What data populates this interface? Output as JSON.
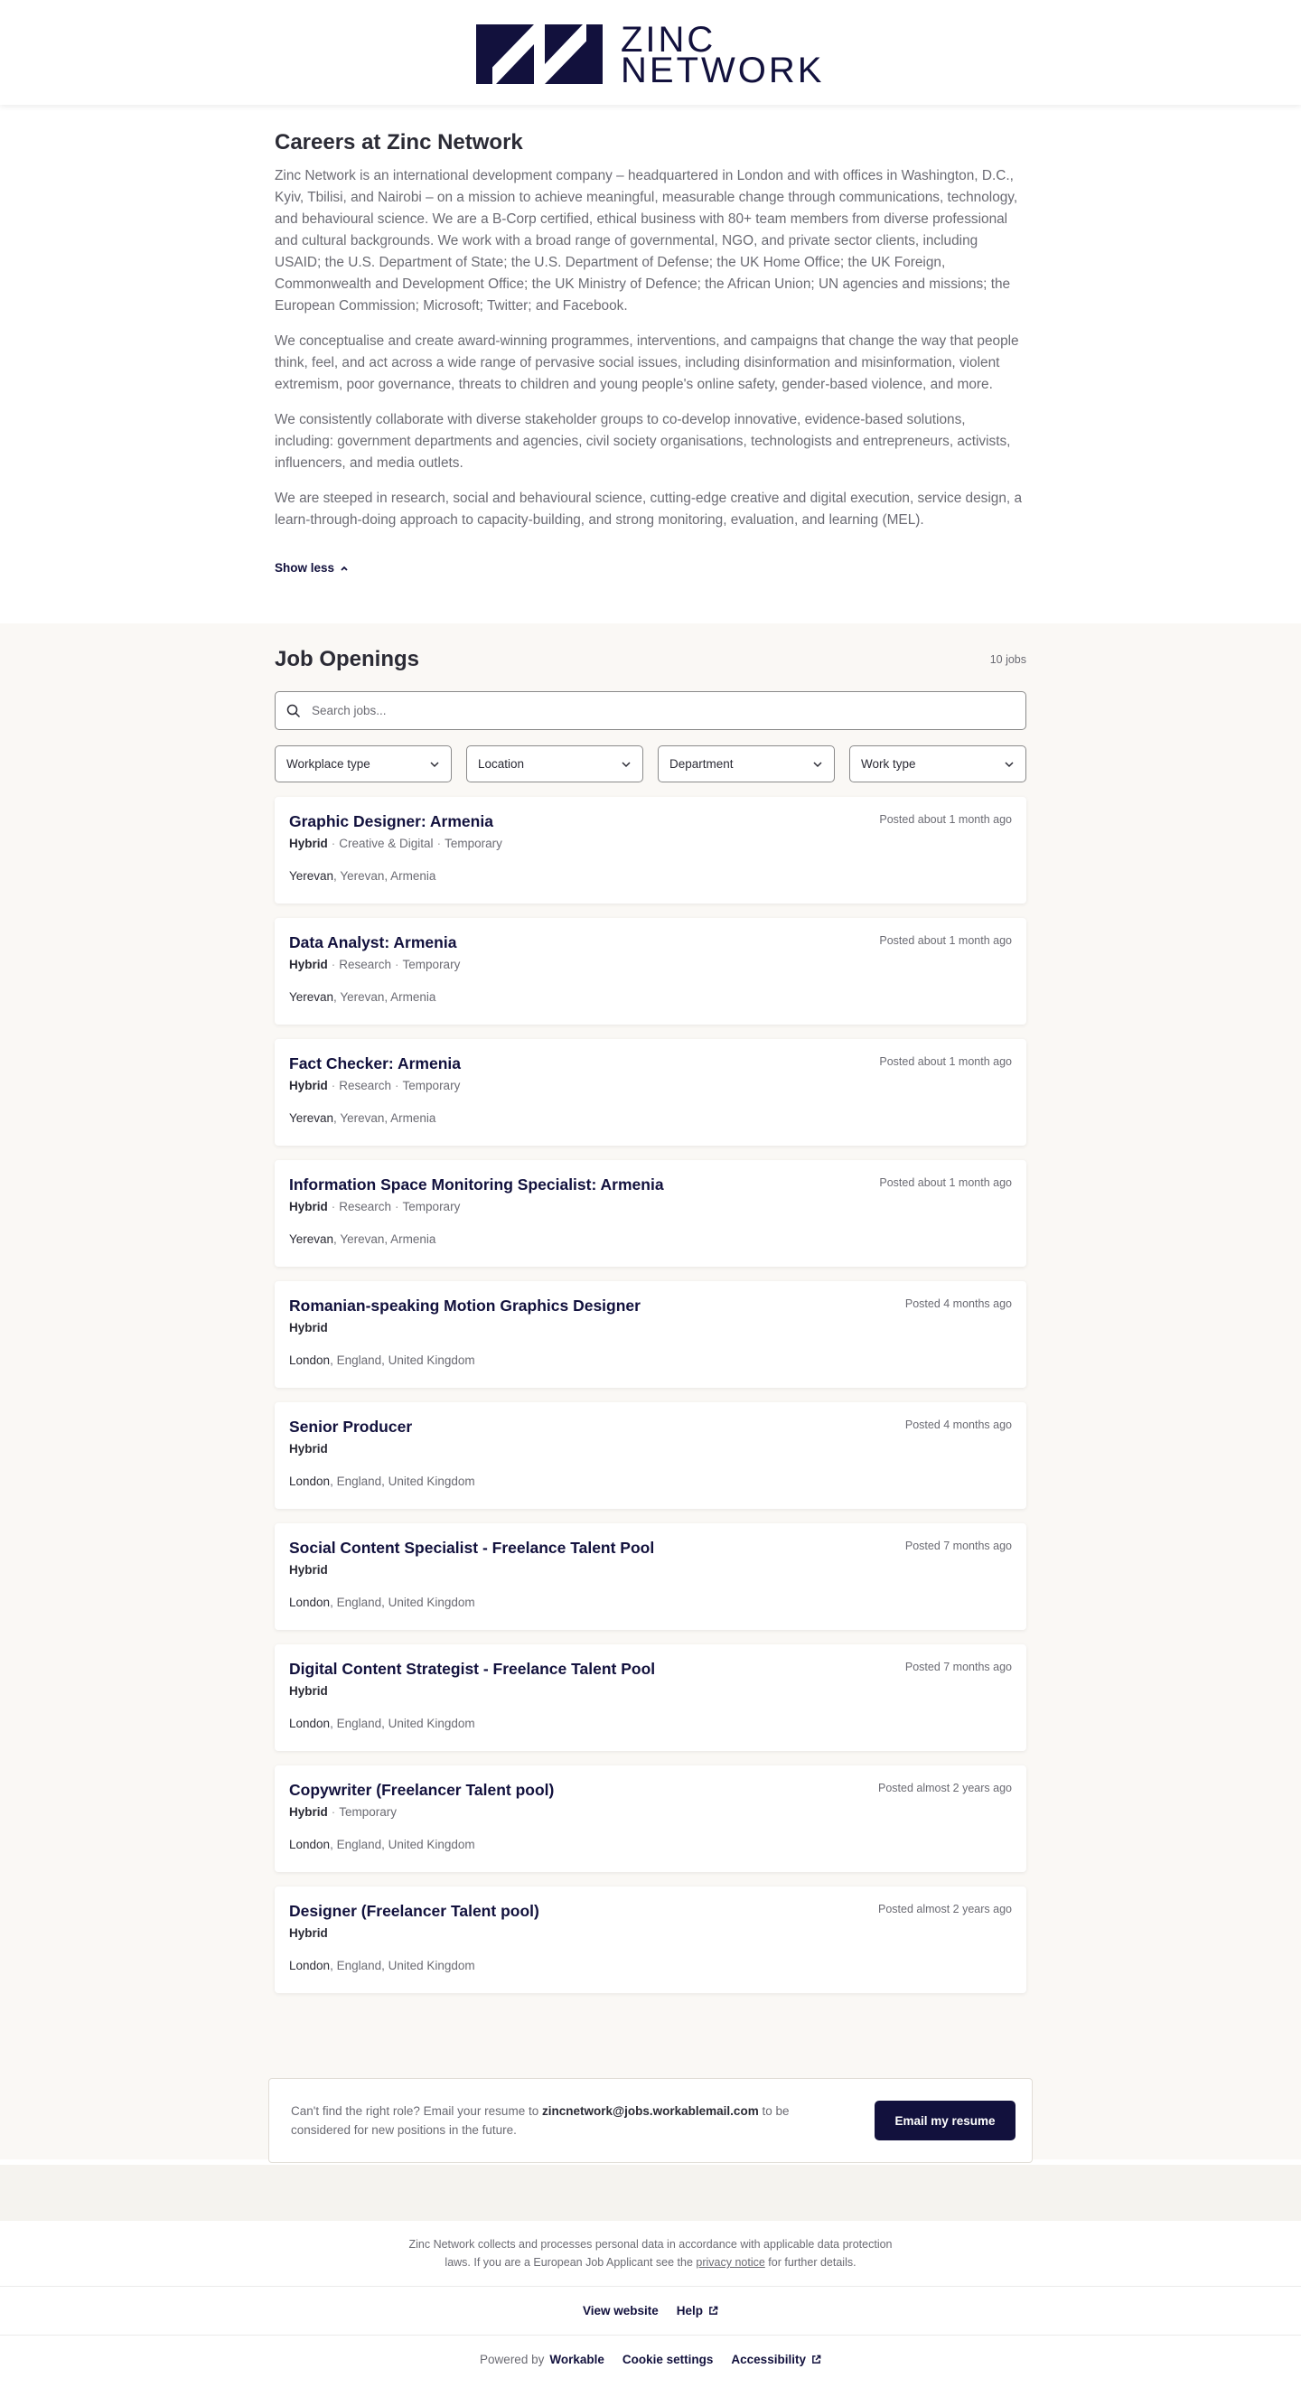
{
  "header": {
    "logo_line1": "ZINC",
    "logo_line2": "NETWORK"
  },
  "intro": {
    "title": "Careers at Zinc Network",
    "paragraphs": [
      "Zinc Network is an international development company – headquartered in London and with offices in Washington, D.C., Kyiv, Tbilisi, and Nairobi – on a mission to achieve meaningful, measurable change through communications, technology, and behavioural science. We are a B-Corp certified, ethical business with 80+ team members from diverse professional and cultural backgrounds. We work with a broad range of governmental, NGO, and private sector clients, including USAID; the U.S. Department of State; the U.S. Department of Defense; the UK Home Office; the UK Foreign, Commonwealth and Development Office; the UK Ministry of Defence; the African Union; UN agencies and missions; the European Commission; Microsoft; Twitter; and Facebook.",
      "We conceptualise and create award-winning programmes, interventions, and campaigns that change the way that people think, feel, and act across a wide range of pervasive social issues, including disinformation and misinformation, violent extremism, poor governance, threats to children and young people's online safety, gender-based violence, and more.",
      "We consistently collaborate with diverse stakeholder groups to co-develop innovative, evidence-based solutions, including: government departments and agencies, civil society organisations, technologists and entrepreneurs, activists, influencers, and media outlets.",
      "We are steeped in research, social and behavioural science, cutting-edge creative and digital execution, service design, a learn-through-doing approach to capacity-building, and strong monitoring, evaluation, and learning (MEL)."
    ],
    "show_less": "Show less"
  },
  "jobs": {
    "heading": "Job Openings",
    "count": "10 jobs",
    "search_placeholder": "Search jobs...",
    "filters": [
      "Workplace type",
      "Location",
      "Department",
      "Work type"
    ],
    "list": [
      {
        "title": "Graphic Designer: Armenia",
        "posted": "Posted about 1 month ago",
        "workplace": "Hybrid",
        "tags": [
          "Creative & Digital",
          "Temporary"
        ],
        "city": "Yerevan",
        "region": "Yerevan, Armenia"
      },
      {
        "title": "Data Analyst: Armenia",
        "posted": "Posted about 1 month ago",
        "workplace": "Hybrid",
        "tags": [
          "Research",
          "Temporary"
        ],
        "city": "Yerevan",
        "region": "Yerevan, Armenia"
      },
      {
        "title": "Fact Checker: Armenia",
        "posted": "Posted about 1 month ago",
        "workplace": "Hybrid",
        "tags": [
          "Research",
          "Temporary"
        ],
        "city": "Yerevan",
        "region": "Yerevan, Armenia"
      },
      {
        "title": "Information Space Monitoring Specialist: Armenia",
        "posted": "Posted about 1 month ago",
        "workplace": "Hybrid",
        "tags": [
          "Research",
          "Temporary"
        ],
        "city": "Yerevan",
        "region": "Yerevan, Armenia"
      },
      {
        "title": "Romanian-speaking Motion Graphics Designer",
        "posted": "Posted 4 months ago",
        "workplace": "Hybrid",
        "tags": [],
        "city": "London",
        "region": "England, United Kingdom"
      },
      {
        "title": "Senior Producer",
        "posted": "Posted 4 months ago",
        "workplace": "Hybrid",
        "tags": [],
        "city": "London",
        "region": "England, United Kingdom"
      },
      {
        "title": "Social Content Specialist - Freelance Talent Pool",
        "posted": "Posted 7 months ago",
        "workplace": "Hybrid",
        "tags": [],
        "city": "London",
        "region": "England, United Kingdom"
      },
      {
        "title": "Digital Content Strategist - Freelance Talent Pool",
        "posted": "Posted 7 months ago",
        "workplace": "Hybrid",
        "tags": [],
        "city": "London",
        "region": "England, United Kingdom"
      },
      {
        "title": "Copywriter (Freelancer Talent pool)",
        "posted": "Posted almost 2 years ago",
        "workplace": "Hybrid",
        "tags": [
          "Temporary"
        ],
        "city": "London",
        "region": "England, United Kingdom"
      },
      {
        "title": "Designer (Freelancer Talent pool)",
        "posted": "Posted almost 2 years ago",
        "workplace": "Hybrid",
        "tags": [],
        "city": "London",
        "region": "England, United Kingdom"
      }
    ]
  },
  "resume": {
    "text_before": "Can't find the right role? Email your resume to ",
    "email": "zincnetwork@jobs.workablemail.com",
    "text_after": " to be considered for new positions in the future.",
    "button": "Email my resume"
  },
  "footer": {
    "privacy_line1": "Zinc Network collects and processes personal data in accordance with applicable data protection",
    "privacy_line2_before": "laws. If you are a European Job Applicant see the ",
    "privacy_link": "privacy notice",
    "privacy_line2_after": " for further details.",
    "view_website": "View website",
    "help": "Help",
    "powered_by": "Powered by",
    "workable": "Workable",
    "cookie_settings": "Cookie settings",
    "accessibility": "Accessibility"
  },
  "colors": {
    "brand": "#12113d",
    "section_bg": "#faf8f5"
  }
}
